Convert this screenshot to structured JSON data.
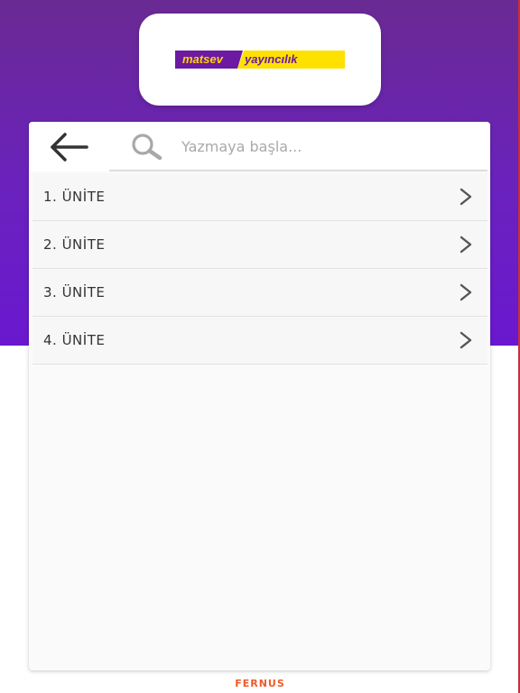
{
  "header": {
    "logo": {
      "part1": "matsev",
      "part2": "yayıncılık"
    }
  },
  "search": {
    "placeholder": "Yazmaya başla...",
    "back_icon": "arrow-left-icon",
    "search_icon": "magnifier-icon"
  },
  "units": [
    {
      "label": "1. ÜNİTE"
    },
    {
      "label": "2. ÜNİTE"
    },
    {
      "label": "3. ÜNİTE"
    },
    {
      "label": "4. ÜNİTE"
    }
  ],
  "footer": {
    "brand": "FERNUS"
  },
  "colors": {
    "header_purple": "#6a22bd",
    "logo_yellow": "#ffe100",
    "logo_purple": "#6c1aa1",
    "footer_orange": "#f05a28"
  }
}
